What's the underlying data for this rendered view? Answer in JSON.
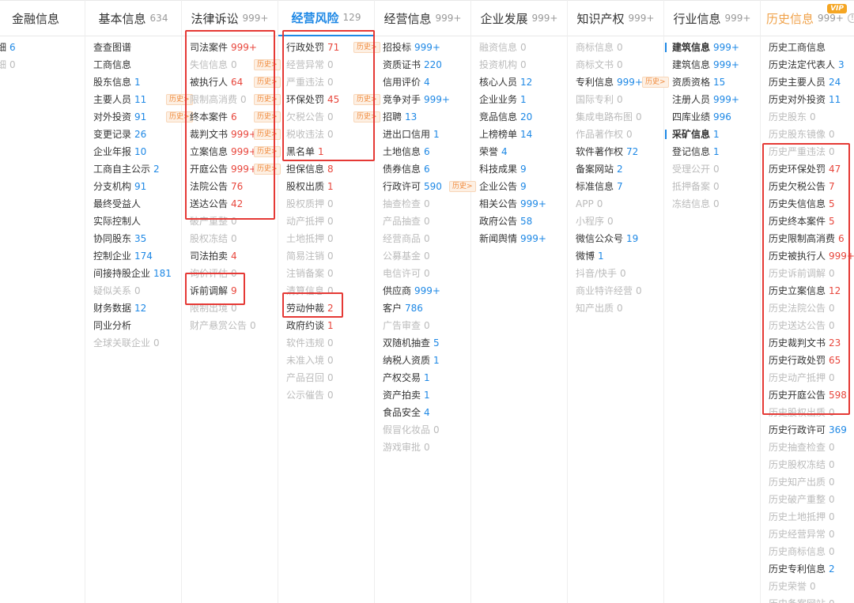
{
  "colors": {
    "accent": "#1e88e5",
    "count_red": "#e8463c",
    "history_tag": "#f08a3c",
    "highlight_box": "#e53935",
    "vip_badge": "#f5a623"
  },
  "columns": [
    {
      "title": "金融信息",
      "count": "",
      "items": [
        {
          "label": "债券明细",
          "count": "6",
          "style": "blue"
        },
        {
          "label": "违约明细",
          "count": "0",
          "style": "zero"
        }
      ]
    },
    {
      "title": "基本信息",
      "count": "634",
      "items": [
        {
          "label": "查查图谱",
          "count": "",
          "style": "plain"
        },
        {
          "label": "工商信息",
          "count": "",
          "style": "plain"
        },
        {
          "label": "股东信息",
          "count": "1",
          "style": "blue"
        },
        {
          "label": "主要人员",
          "count": "11",
          "style": "blue",
          "tag": "历史>"
        },
        {
          "label": "对外投资",
          "count": "91",
          "style": "blue",
          "tag": "历史>"
        },
        {
          "label": "变更记录",
          "count": "26",
          "style": "blue"
        },
        {
          "label": "企业年报",
          "count": "10",
          "style": "blue"
        },
        {
          "label": "工商自主公示",
          "count": "2",
          "style": "blue"
        },
        {
          "label": "分支机构",
          "count": "91",
          "style": "blue"
        },
        {
          "label": "最终受益人",
          "count": "",
          "style": "plain"
        },
        {
          "label": "实际控制人",
          "count": "",
          "style": "plain"
        },
        {
          "label": "协同股东",
          "count": "35",
          "style": "blue"
        },
        {
          "label": "控制企业",
          "count": "174",
          "style": "blue"
        },
        {
          "label": "间接持股企业",
          "count": "181",
          "style": "blue"
        },
        {
          "label": "疑似关系",
          "count": "0",
          "style": "zero"
        },
        {
          "label": "财务数据",
          "count": "12",
          "style": "blue"
        },
        {
          "label": "同业分析",
          "count": "",
          "style": "plain"
        },
        {
          "label": "全球关联企业",
          "count": "0",
          "style": "zero"
        }
      ]
    },
    {
      "title": "法律诉讼",
      "count": "999+",
      "items": [
        {
          "label": "司法案件",
          "count": "999+",
          "style": "red"
        },
        {
          "label": "失信信息",
          "count": "0",
          "style": "zero",
          "tag": "历史>"
        },
        {
          "label": "被执行人",
          "count": "64",
          "style": "red",
          "tag": "历史>"
        },
        {
          "label": "限制高消费",
          "count": "0",
          "style": "zero",
          "tag": "历史>"
        },
        {
          "label": "终本案件",
          "count": "6",
          "style": "red",
          "tag": "历史>"
        },
        {
          "label": "裁判文书",
          "count": "999+",
          "style": "red",
          "tag": "历史>"
        },
        {
          "label": "立案信息",
          "count": "999+",
          "style": "red",
          "tag": "历史>"
        },
        {
          "label": "开庭公告",
          "count": "999+",
          "style": "red",
          "tag": "历史>"
        },
        {
          "label": "法院公告",
          "count": "76",
          "style": "red"
        },
        {
          "label": "送达公告",
          "count": "42",
          "style": "red"
        },
        {
          "label": "破产重整",
          "count": "0",
          "style": "zero"
        },
        {
          "label": "股权冻结",
          "count": "0",
          "style": "zero"
        },
        {
          "label": "司法拍卖",
          "count": "4",
          "style": "red"
        },
        {
          "label": "询价评估",
          "count": "0",
          "style": "zero"
        },
        {
          "label": "诉前调解",
          "count": "9",
          "style": "red"
        },
        {
          "label": "限制出境",
          "count": "0",
          "style": "zero"
        },
        {
          "label": "财产悬赏公告",
          "count": "0",
          "style": "zero"
        }
      ]
    },
    {
      "title": "经营风险",
      "count": "129",
      "active": true,
      "items": [
        {
          "label": "行政处罚",
          "count": "71",
          "style": "red",
          "tag": "历史>"
        },
        {
          "label": "经营异常",
          "count": "0",
          "style": "zero"
        },
        {
          "label": "严重违法",
          "count": "0",
          "style": "zero"
        },
        {
          "label": "环保处罚",
          "count": "45",
          "style": "red",
          "tag": "历史>"
        },
        {
          "label": "欠税公告",
          "count": "0",
          "style": "zero",
          "tag": "历史>"
        },
        {
          "label": "税收违法",
          "count": "0",
          "style": "zero"
        },
        {
          "label": "黑名单",
          "count": "1",
          "style": "red"
        },
        {
          "label": "担保信息",
          "count": "8",
          "style": "red"
        },
        {
          "label": "股权出质",
          "count": "1",
          "style": "red"
        },
        {
          "label": "股权质押",
          "count": "0",
          "style": "zero"
        },
        {
          "label": "动产抵押",
          "count": "0",
          "style": "zero"
        },
        {
          "label": "土地抵押",
          "count": "0",
          "style": "zero"
        },
        {
          "label": "简易注销",
          "count": "0",
          "style": "zero"
        },
        {
          "label": "注销备案",
          "count": "0",
          "style": "zero"
        },
        {
          "label": "清算信息",
          "count": "0",
          "style": "zero"
        },
        {
          "label": "劳动仲裁",
          "count": "2",
          "style": "red"
        },
        {
          "label": "政府约谈",
          "count": "1",
          "style": "red"
        },
        {
          "label": "软件违规",
          "count": "0",
          "style": "zero"
        },
        {
          "label": "未准入境",
          "count": "0",
          "style": "zero"
        },
        {
          "label": "产品召回",
          "count": "0",
          "style": "zero"
        },
        {
          "label": "公示催告",
          "count": "0",
          "style": "zero"
        }
      ]
    },
    {
      "title": "经营信息",
      "count": "999+",
      "items": [
        {
          "label": "招投标",
          "count": "999+",
          "style": "blue"
        },
        {
          "label": "资质证书",
          "count": "220",
          "style": "blue"
        },
        {
          "label": "信用评价",
          "count": "4",
          "style": "blue"
        },
        {
          "label": "竞争对手",
          "count": "999+",
          "style": "blue"
        },
        {
          "label": "招聘",
          "count": "13",
          "style": "blue"
        },
        {
          "label": "进出口信用",
          "count": "1",
          "style": "blue"
        },
        {
          "label": "土地信息",
          "count": "6",
          "style": "blue"
        },
        {
          "label": "债券信息",
          "count": "6",
          "style": "blue"
        },
        {
          "label": "行政许可",
          "count": "590",
          "style": "blue",
          "tag": "历史>"
        },
        {
          "label": "抽查检查",
          "count": "0",
          "style": "zero"
        },
        {
          "label": "产品抽查",
          "count": "0",
          "style": "zero"
        },
        {
          "label": "经营商品",
          "count": "0",
          "style": "zero"
        },
        {
          "label": "公募基金",
          "count": "0",
          "style": "zero"
        },
        {
          "label": "电信许可",
          "count": "0",
          "style": "zero"
        },
        {
          "label": "供应商",
          "count": "999+",
          "style": "blue"
        },
        {
          "label": "客户",
          "count": "786",
          "style": "blue"
        },
        {
          "label": "广告审查",
          "count": "0",
          "style": "zero"
        },
        {
          "label": "双随机抽查",
          "count": "5",
          "style": "blue"
        },
        {
          "label": "纳税人资质",
          "count": "1",
          "style": "blue"
        },
        {
          "label": "产权交易",
          "count": "1",
          "style": "blue"
        },
        {
          "label": "资产拍卖",
          "count": "1",
          "style": "blue"
        },
        {
          "label": "食品安全",
          "count": "4",
          "style": "blue"
        },
        {
          "label": "假冒化妆品",
          "count": "0",
          "style": "zero"
        },
        {
          "label": "游戏审批",
          "count": "0",
          "style": "zero"
        }
      ]
    },
    {
      "title": "企业发展",
      "count": "999+",
      "items": [
        {
          "label": "融资信息",
          "count": "0",
          "style": "zero"
        },
        {
          "label": "投资机构",
          "count": "0",
          "style": "zero"
        },
        {
          "label": "核心人员",
          "count": "12",
          "style": "blue"
        },
        {
          "label": "企业业务",
          "count": "1",
          "style": "blue"
        },
        {
          "label": "竞品信息",
          "count": "20",
          "style": "blue"
        },
        {
          "label": "上榜榜单",
          "count": "14",
          "style": "blue"
        },
        {
          "label": "荣誉",
          "count": "4",
          "style": "blue"
        },
        {
          "label": "科技成果",
          "count": "9",
          "style": "blue"
        },
        {
          "label": "企业公告",
          "count": "9",
          "style": "blue"
        },
        {
          "label": "相关公告",
          "count": "999+",
          "style": "blue"
        },
        {
          "label": "政府公告",
          "count": "58",
          "style": "blue"
        },
        {
          "label": "新闻舆情",
          "count": "999+",
          "style": "blue"
        }
      ]
    },
    {
      "title": "知识产权",
      "count": "999+",
      "items": [
        {
          "label": "商标信息",
          "count": "0",
          "style": "zero"
        },
        {
          "label": "商标文书",
          "count": "0",
          "style": "zero"
        },
        {
          "label": "专利信息",
          "count": "999+",
          "style": "blue",
          "tag": "历史>"
        },
        {
          "label": "国际专利",
          "count": "0",
          "style": "zero"
        },
        {
          "label": "集成电路布图",
          "count": "0",
          "style": "zero"
        },
        {
          "label": "作品著作权",
          "count": "0",
          "style": "zero"
        },
        {
          "label": "软件著作权",
          "count": "72",
          "style": "blue"
        },
        {
          "label": "备案网站",
          "count": "2",
          "style": "blue"
        },
        {
          "label": "标准信息",
          "count": "7",
          "style": "blue"
        },
        {
          "label": "APP",
          "count": "0",
          "style": "zero"
        },
        {
          "label": "小程序",
          "count": "0",
          "style": "zero"
        },
        {
          "label": "微信公众号",
          "count": "19",
          "style": "blue"
        },
        {
          "label": "微博",
          "count": "1",
          "style": "blue"
        },
        {
          "label": "抖音/快手",
          "count": "0",
          "style": "zero"
        },
        {
          "label": "商业特许经营",
          "count": "0",
          "style": "zero"
        },
        {
          "label": "知产出质",
          "count": "0",
          "style": "zero"
        }
      ]
    },
    {
      "title": "行业信息",
      "count": "999+",
      "items": [
        {
          "label": "建筑信息",
          "count": "999+",
          "style": "blue",
          "section": true
        },
        {
          "label": "建筑信息",
          "count": "999+",
          "style": "blue"
        },
        {
          "label": "资质资格",
          "count": "15",
          "style": "blue"
        },
        {
          "label": "注册人员",
          "count": "999+",
          "style": "blue"
        },
        {
          "label": "四库业绩",
          "count": "996",
          "style": "blue"
        },
        {
          "label": "采矿信息",
          "count": "1",
          "style": "blue",
          "section": true
        },
        {
          "label": "登记信息",
          "count": "1",
          "style": "blue"
        },
        {
          "label": "受理公开",
          "count": "0",
          "style": "zero"
        },
        {
          "label": "抵押备案",
          "count": "0",
          "style": "zero"
        },
        {
          "label": "冻结信息",
          "count": "0",
          "style": "zero"
        }
      ]
    },
    {
      "title": "历史信息",
      "count": "999+",
      "hist": true,
      "vip": "VIP",
      "items": [
        {
          "label": "历史工商信息",
          "count": "",
          "style": "plain"
        },
        {
          "label": "历史法定代表人",
          "count": "3",
          "style": "blue"
        },
        {
          "label": "历史主要人员",
          "count": "24",
          "style": "blue"
        },
        {
          "label": "历史对外投资",
          "count": "11",
          "style": "blue"
        },
        {
          "label": "历史股东",
          "count": "0",
          "style": "zero"
        },
        {
          "label": "历史股东镜像",
          "count": "0",
          "style": "zero"
        },
        {
          "label": "历史严重违法",
          "count": "0",
          "style": "zero"
        },
        {
          "label": "历史环保处罚",
          "count": "47",
          "style": "red"
        },
        {
          "label": "历史欠税公告",
          "count": "7",
          "style": "red"
        },
        {
          "label": "历史失信信息",
          "count": "5",
          "style": "red"
        },
        {
          "label": "历史终本案件",
          "count": "5",
          "style": "red"
        },
        {
          "label": "历史限制高消费",
          "count": "6",
          "style": "red"
        },
        {
          "label": "历史被执行人",
          "count": "999+",
          "style": "red"
        },
        {
          "label": "历史诉前调解",
          "count": "0",
          "style": "zero"
        },
        {
          "label": "历史立案信息",
          "count": "12",
          "style": "red"
        },
        {
          "label": "历史法院公告",
          "count": "0",
          "style": "zero"
        },
        {
          "label": "历史送达公告",
          "count": "0",
          "style": "zero"
        },
        {
          "label": "历史裁判文书",
          "count": "23",
          "style": "red"
        },
        {
          "label": "历史行政处罚",
          "count": "65",
          "style": "red"
        },
        {
          "label": "历史动产抵押",
          "count": "0",
          "style": "zero"
        },
        {
          "label": "历史开庭公告",
          "count": "598",
          "style": "red"
        },
        {
          "label": "历史股权出质",
          "count": "0",
          "style": "zero"
        },
        {
          "label": "历史行政许可",
          "count": "369",
          "style": "blue"
        },
        {
          "label": "历史抽查检查",
          "count": "0",
          "style": "zero"
        },
        {
          "label": "历史股权冻结",
          "count": "0",
          "style": "zero"
        },
        {
          "label": "历史知产出质",
          "count": "0",
          "style": "zero"
        },
        {
          "label": "历史破产重整",
          "count": "0",
          "style": "zero"
        },
        {
          "label": "历史土地抵押",
          "count": "0",
          "style": "zero"
        },
        {
          "label": "历史经营异常",
          "count": "0",
          "style": "zero"
        },
        {
          "label": "历史商标信息",
          "count": "0",
          "style": "zero"
        },
        {
          "label": "历史专利信息",
          "count": "2",
          "style": "blue"
        },
        {
          "label": "历史荣誉",
          "count": "0",
          "style": "zero"
        },
        {
          "label": "历史备案网站",
          "count": "0",
          "style": "zero"
        }
      ]
    }
  ]
}
